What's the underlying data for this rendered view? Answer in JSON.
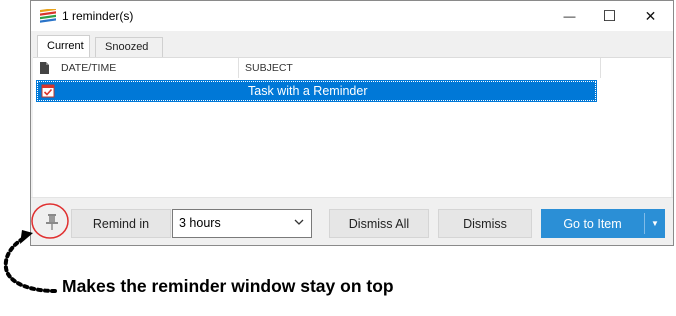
{
  "window": {
    "title": "1 reminder(s)",
    "controls": {
      "minimize": "—",
      "maximize": "☐",
      "close": "✕"
    }
  },
  "tabs": [
    {
      "label": "Current",
      "active": true
    },
    {
      "label": "Snoozed",
      "active": false
    }
  ],
  "table": {
    "columns": [
      "DATE/TIME",
      "SUBJECT"
    ],
    "rows": [
      {
        "datetime": "",
        "subject": "Task with a Reminder",
        "selected": true,
        "icon": "task-icon"
      }
    ]
  },
  "footer": {
    "remind_label": "Remind in",
    "snooze_value": "3 hours",
    "dismiss_all_label": "Dismiss All",
    "dismiss_label": "Dismiss",
    "go_to_item_label": "Go to Item"
  },
  "annotation": {
    "text": "Makes the reminder window stay on top"
  },
  "colors": {
    "selection": "#0078d7",
    "primary_button": "#2b8fd6",
    "callout_circle": "#e03030"
  }
}
